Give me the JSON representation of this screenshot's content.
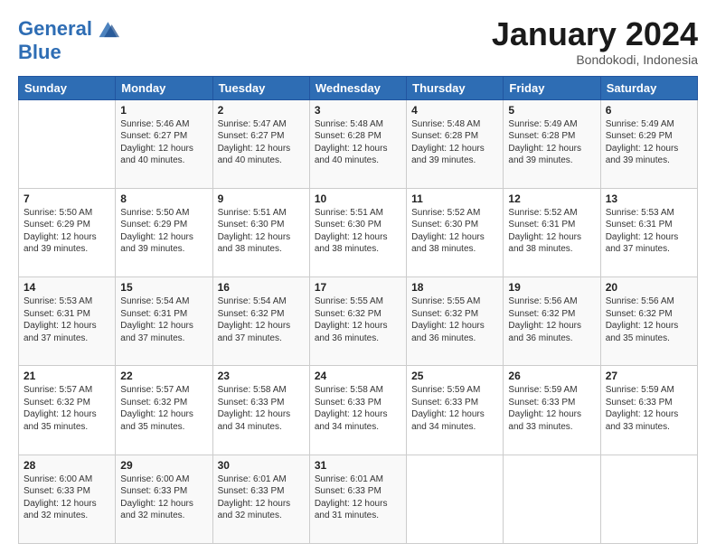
{
  "header": {
    "logo_line1": "General",
    "logo_line2": "Blue",
    "month": "January 2024",
    "location": "Bondokodi, Indonesia"
  },
  "days_of_week": [
    "Sunday",
    "Monday",
    "Tuesday",
    "Wednesday",
    "Thursday",
    "Friday",
    "Saturday"
  ],
  "weeks": [
    [
      {
        "num": "",
        "info": ""
      },
      {
        "num": "1",
        "info": "Sunrise: 5:46 AM\nSunset: 6:27 PM\nDaylight: 12 hours\nand 40 minutes."
      },
      {
        "num": "2",
        "info": "Sunrise: 5:47 AM\nSunset: 6:27 PM\nDaylight: 12 hours\nand 40 minutes."
      },
      {
        "num": "3",
        "info": "Sunrise: 5:48 AM\nSunset: 6:28 PM\nDaylight: 12 hours\nand 40 minutes."
      },
      {
        "num": "4",
        "info": "Sunrise: 5:48 AM\nSunset: 6:28 PM\nDaylight: 12 hours\nand 39 minutes."
      },
      {
        "num": "5",
        "info": "Sunrise: 5:49 AM\nSunset: 6:28 PM\nDaylight: 12 hours\nand 39 minutes."
      },
      {
        "num": "6",
        "info": "Sunrise: 5:49 AM\nSunset: 6:29 PM\nDaylight: 12 hours\nand 39 minutes."
      }
    ],
    [
      {
        "num": "7",
        "info": "Sunrise: 5:50 AM\nSunset: 6:29 PM\nDaylight: 12 hours\nand 39 minutes."
      },
      {
        "num": "8",
        "info": "Sunrise: 5:50 AM\nSunset: 6:29 PM\nDaylight: 12 hours\nand 39 minutes."
      },
      {
        "num": "9",
        "info": "Sunrise: 5:51 AM\nSunset: 6:30 PM\nDaylight: 12 hours\nand 38 minutes."
      },
      {
        "num": "10",
        "info": "Sunrise: 5:51 AM\nSunset: 6:30 PM\nDaylight: 12 hours\nand 38 minutes."
      },
      {
        "num": "11",
        "info": "Sunrise: 5:52 AM\nSunset: 6:30 PM\nDaylight: 12 hours\nand 38 minutes."
      },
      {
        "num": "12",
        "info": "Sunrise: 5:52 AM\nSunset: 6:31 PM\nDaylight: 12 hours\nand 38 minutes."
      },
      {
        "num": "13",
        "info": "Sunrise: 5:53 AM\nSunset: 6:31 PM\nDaylight: 12 hours\nand 37 minutes."
      }
    ],
    [
      {
        "num": "14",
        "info": "Sunrise: 5:53 AM\nSunset: 6:31 PM\nDaylight: 12 hours\nand 37 minutes."
      },
      {
        "num": "15",
        "info": "Sunrise: 5:54 AM\nSunset: 6:31 PM\nDaylight: 12 hours\nand 37 minutes."
      },
      {
        "num": "16",
        "info": "Sunrise: 5:54 AM\nSunset: 6:32 PM\nDaylight: 12 hours\nand 37 minutes."
      },
      {
        "num": "17",
        "info": "Sunrise: 5:55 AM\nSunset: 6:32 PM\nDaylight: 12 hours\nand 36 minutes."
      },
      {
        "num": "18",
        "info": "Sunrise: 5:55 AM\nSunset: 6:32 PM\nDaylight: 12 hours\nand 36 minutes."
      },
      {
        "num": "19",
        "info": "Sunrise: 5:56 AM\nSunset: 6:32 PM\nDaylight: 12 hours\nand 36 minutes."
      },
      {
        "num": "20",
        "info": "Sunrise: 5:56 AM\nSunset: 6:32 PM\nDaylight: 12 hours\nand 35 minutes."
      }
    ],
    [
      {
        "num": "21",
        "info": "Sunrise: 5:57 AM\nSunset: 6:32 PM\nDaylight: 12 hours\nand 35 minutes."
      },
      {
        "num": "22",
        "info": "Sunrise: 5:57 AM\nSunset: 6:32 PM\nDaylight: 12 hours\nand 35 minutes."
      },
      {
        "num": "23",
        "info": "Sunrise: 5:58 AM\nSunset: 6:33 PM\nDaylight: 12 hours\nand 34 minutes."
      },
      {
        "num": "24",
        "info": "Sunrise: 5:58 AM\nSunset: 6:33 PM\nDaylight: 12 hours\nand 34 minutes."
      },
      {
        "num": "25",
        "info": "Sunrise: 5:59 AM\nSunset: 6:33 PM\nDaylight: 12 hours\nand 34 minutes."
      },
      {
        "num": "26",
        "info": "Sunrise: 5:59 AM\nSunset: 6:33 PM\nDaylight: 12 hours\nand 33 minutes."
      },
      {
        "num": "27",
        "info": "Sunrise: 5:59 AM\nSunset: 6:33 PM\nDaylight: 12 hours\nand 33 minutes."
      }
    ],
    [
      {
        "num": "28",
        "info": "Sunrise: 6:00 AM\nSunset: 6:33 PM\nDaylight: 12 hours\nand 32 minutes."
      },
      {
        "num": "29",
        "info": "Sunrise: 6:00 AM\nSunset: 6:33 PM\nDaylight: 12 hours\nand 32 minutes."
      },
      {
        "num": "30",
        "info": "Sunrise: 6:01 AM\nSunset: 6:33 PM\nDaylight: 12 hours\nand 32 minutes."
      },
      {
        "num": "31",
        "info": "Sunrise: 6:01 AM\nSunset: 6:33 PM\nDaylight: 12 hours\nand 31 minutes."
      },
      {
        "num": "",
        "info": ""
      },
      {
        "num": "",
        "info": ""
      },
      {
        "num": "",
        "info": ""
      }
    ]
  ]
}
